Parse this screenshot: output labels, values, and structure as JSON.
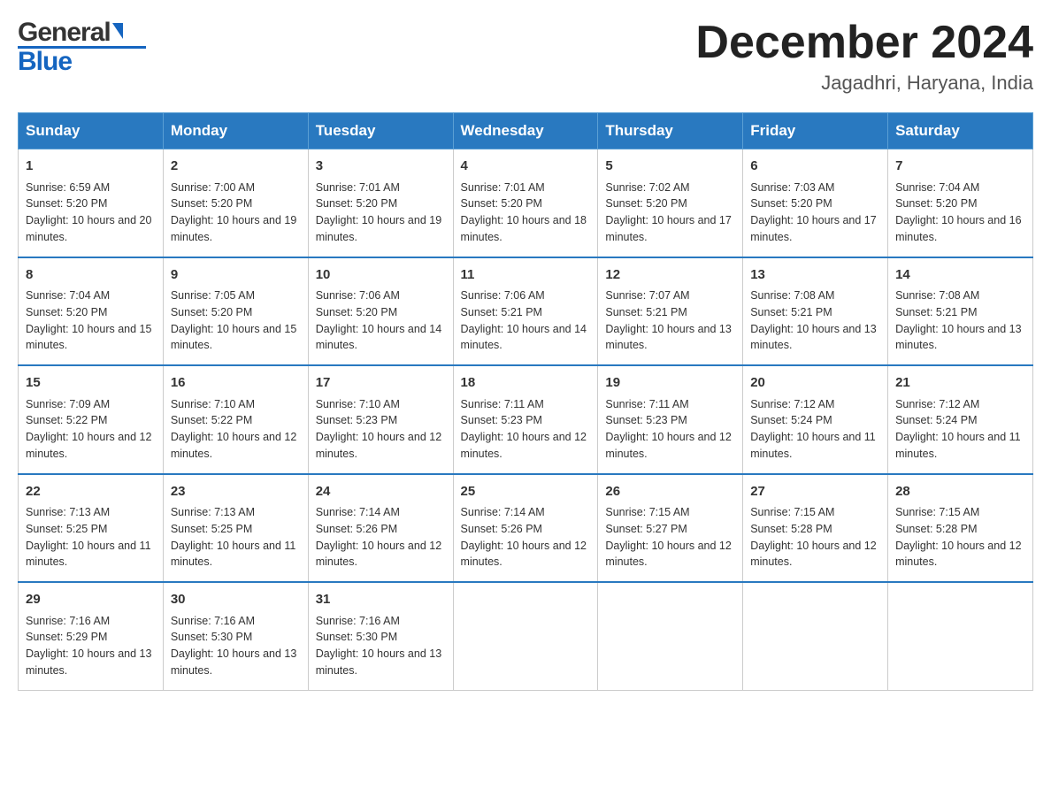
{
  "header": {
    "logo": {
      "part1": "General",
      "part2": "Blue"
    },
    "title": "December 2024",
    "location": "Jagadhri, Haryana, India"
  },
  "days_of_week": [
    "Sunday",
    "Monday",
    "Tuesday",
    "Wednesday",
    "Thursday",
    "Friday",
    "Saturday"
  ],
  "weeks": [
    [
      {
        "day": "1",
        "sunrise": "6:59 AM",
        "sunset": "5:20 PM",
        "daylight": "10 hours and 20 minutes."
      },
      {
        "day": "2",
        "sunrise": "7:00 AM",
        "sunset": "5:20 PM",
        "daylight": "10 hours and 19 minutes."
      },
      {
        "day": "3",
        "sunrise": "7:01 AM",
        "sunset": "5:20 PM",
        "daylight": "10 hours and 19 minutes."
      },
      {
        "day": "4",
        "sunrise": "7:01 AM",
        "sunset": "5:20 PM",
        "daylight": "10 hours and 18 minutes."
      },
      {
        "day": "5",
        "sunrise": "7:02 AM",
        "sunset": "5:20 PM",
        "daylight": "10 hours and 17 minutes."
      },
      {
        "day": "6",
        "sunrise": "7:03 AM",
        "sunset": "5:20 PM",
        "daylight": "10 hours and 17 minutes."
      },
      {
        "day": "7",
        "sunrise": "7:04 AM",
        "sunset": "5:20 PM",
        "daylight": "10 hours and 16 minutes."
      }
    ],
    [
      {
        "day": "8",
        "sunrise": "7:04 AM",
        "sunset": "5:20 PM",
        "daylight": "10 hours and 15 minutes."
      },
      {
        "day": "9",
        "sunrise": "7:05 AM",
        "sunset": "5:20 PM",
        "daylight": "10 hours and 15 minutes."
      },
      {
        "day": "10",
        "sunrise": "7:06 AM",
        "sunset": "5:20 PM",
        "daylight": "10 hours and 14 minutes."
      },
      {
        "day": "11",
        "sunrise": "7:06 AM",
        "sunset": "5:21 PM",
        "daylight": "10 hours and 14 minutes."
      },
      {
        "day": "12",
        "sunrise": "7:07 AM",
        "sunset": "5:21 PM",
        "daylight": "10 hours and 13 minutes."
      },
      {
        "day": "13",
        "sunrise": "7:08 AM",
        "sunset": "5:21 PM",
        "daylight": "10 hours and 13 minutes."
      },
      {
        "day": "14",
        "sunrise": "7:08 AM",
        "sunset": "5:21 PM",
        "daylight": "10 hours and 13 minutes."
      }
    ],
    [
      {
        "day": "15",
        "sunrise": "7:09 AM",
        "sunset": "5:22 PM",
        "daylight": "10 hours and 12 minutes."
      },
      {
        "day": "16",
        "sunrise": "7:10 AM",
        "sunset": "5:22 PM",
        "daylight": "10 hours and 12 minutes."
      },
      {
        "day": "17",
        "sunrise": "7:10 AM",
        "sunset": "5:23 PM",
        "daylight": "10 hours and 12 minutes."
      },
      {
        "day": "18",
        "sunrise": "7:11 AM",
        "sunset": "5:23 PM",
        "daylight": "10 hours and 12 minutes."
      },
      {
        "day": "19",
        "sunrise": "7:11 AM",
        "sunset": "5:23 PM",
        "daylight": "10 hours and 12 minutes."
      },
      {
        "day": "20",
        "sunrise": "7:12 AM",
        "sunset": "5:24 PM",
        "daylight": "10 hours and 11 minutes."
      },
      {
        "day": "21",
        "sunrise": "7:12 AM",
        "sunset": "5:24 PM",
        "daylight": "10 hours and 11 minutes."
      }
    ],
    [
      {
        "day": "22",
        "sunrise": "7:13 AM",
        "sunset": "5:25 PM",
        "daylight": "10 hours and 11 minutes."
      },
      {
        "day": "23",
        "sunrise": "7:13 AM",
        "sunset": "5:25 PM",
        "daylight": "10 hours and 11 minutes."
      },
      {
        "day": "24",
        "sunrise": "7:14 AM",
        "sunset": "5:26 PM",
        "daylight": "10 hours and 12 minutes."
      },
      {
        "day": "25",
        "sunrise": "7:14 AM",
        "sunset": "5:26 PM",
        "daylight": "10 hours and 12 minutes."
      },
      {
        "day": "26",
        "sunrise": "7:15 AM",
        "sunset": "5:27 PM",
        "daylight": "10 hours and 12 minutes."
      },
      {
        "day": "27",
        "sunrise": "7:15 AM",
        "sunset": "5:28 PM",
        "daylight": "10 hours and 12 minutes."
      },
      {
        "day": "28",
        "sunrise": "7:15 AM",
        "sunset": "5:28 PM",
        "daylight": "10 hours and 12 minutes."
      }
    ],
    [
      {
        "day": "29",
        "sunrise": "7:16 AM",
        "sunset": "5:29 PM",
        "daylight": "10 hours and 13 minutes."
      },
      {
        "day": "30",
        "sunrise": "7:16 AM",
        "sunset": "5:30 PM",
        "daylight": "10 hours and 13 minutes."
      },
      {
        "day": "31",
        "sunrise": "7:16 AM",
        "sunset": "5:30 PM",
        "daylight": "10 hours and 13 minutes."
      },
      null,
      null,
      null,
      null
    ]
  ],
  "labels": {
    "sunrise": "Sunrise:",
    "sunset": "Sunset:",
    "daylight": "Daylight:"
  }
}
